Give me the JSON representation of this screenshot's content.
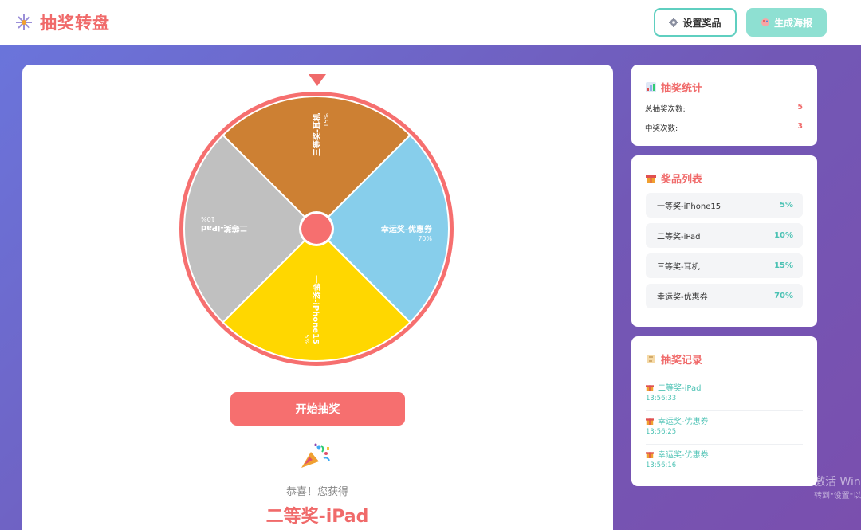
{
  "header": {
    "title": "抽奖转盘",
    "settings_button": "设置奖品",
    "poster_button": "生成海报"
  },
  "wheel": {
    "segments": [
      {
        "label": "三等奖-耳机",
        "percent": "15%",
        "color": "#cd8033"
      },
      {
        "label": "幸运奖-优惠券",
        "percent": "70%",
        "color": "#87ceeb"
      },
      {
        "label": "一等奖-iPhone15",
        "percent": "5%",
        "color": "#ffd700"
      },
      {
        "label": "二等奖-iPad",
        "percent": "10%",
        "color": "#c0c0c0"
      }
    ],
    "rim_color": "#f66f6f"
  },
  "start_button": "开始抽奖",
  "result": {
    "congrats": "恭喜！您获得",
    "prize": "二等奖-iPad"
  },
  "stats": {
    "title": "抽奖统计",
    "total_label": "总抽奖次数:",
    "total_value": "5",
    "win_label": "中奖次数:",
    "win_value": "3"
  },
  "prize_list": {
    "title": "奖品列表",
    "items": [
      {
        "name": "一等奖-iPhone15",
        "percent": "5%"
      },
      {
        "name": "二等奖-iPad",
        "percent": "10%"
      },
      {
        "name": "三等奖-耳机",
        "percent": "15%"
      },
      {
        "name": "幸运奖-优惠券",
        "percent": "70%"
      }
    ]
  },
  "records": {
    "title": "抽奖记录",
    "items": [
      {
        "name": "二等奖-iPad",
        "time": "13:56:33"
      },
      {
        "name": "幸运奖-优惠券",
        "time": "13:56:25"
      },
      {
        "name": "幸运奖-优惠券",
        "time": "13:56:16"
      }
    ]
  },
  "watermark": {
    "line1": "激活 Win",
    "line2": "转到\"设置\"以"
  },
  "colors": {
    "accent": "#f06a6a",
    "teal": "#4cc2b4"
  }
}
